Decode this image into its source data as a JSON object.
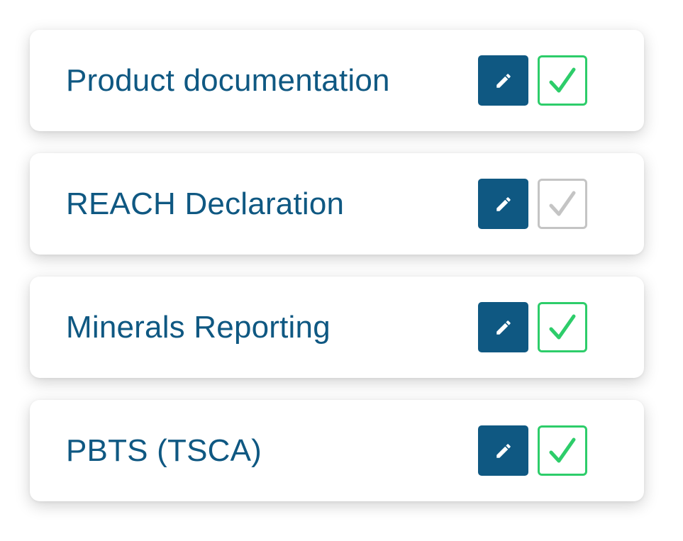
{
  "items": [
    {
      "label": "Product documentation",
      "checked": true
    },
    {
      "label": "REACH Declaration",
      "checked": false
    },
    {
      "label": "Minerals Reporting",
      "checked": true
    },
    {
      "label": "PBTS (TSCA)",
      "checked": true
    }
  ],
  "icons": {
    "edit": "pencil-icon",
    "check": "checkmark-icon"
  },
  "colors": {
    "primary": "#0f5882",
    "check_on": "#2dcd6a",
    "check_off": "#c4c4c4",
    "card_bg": "#ffffff"
  }
}
